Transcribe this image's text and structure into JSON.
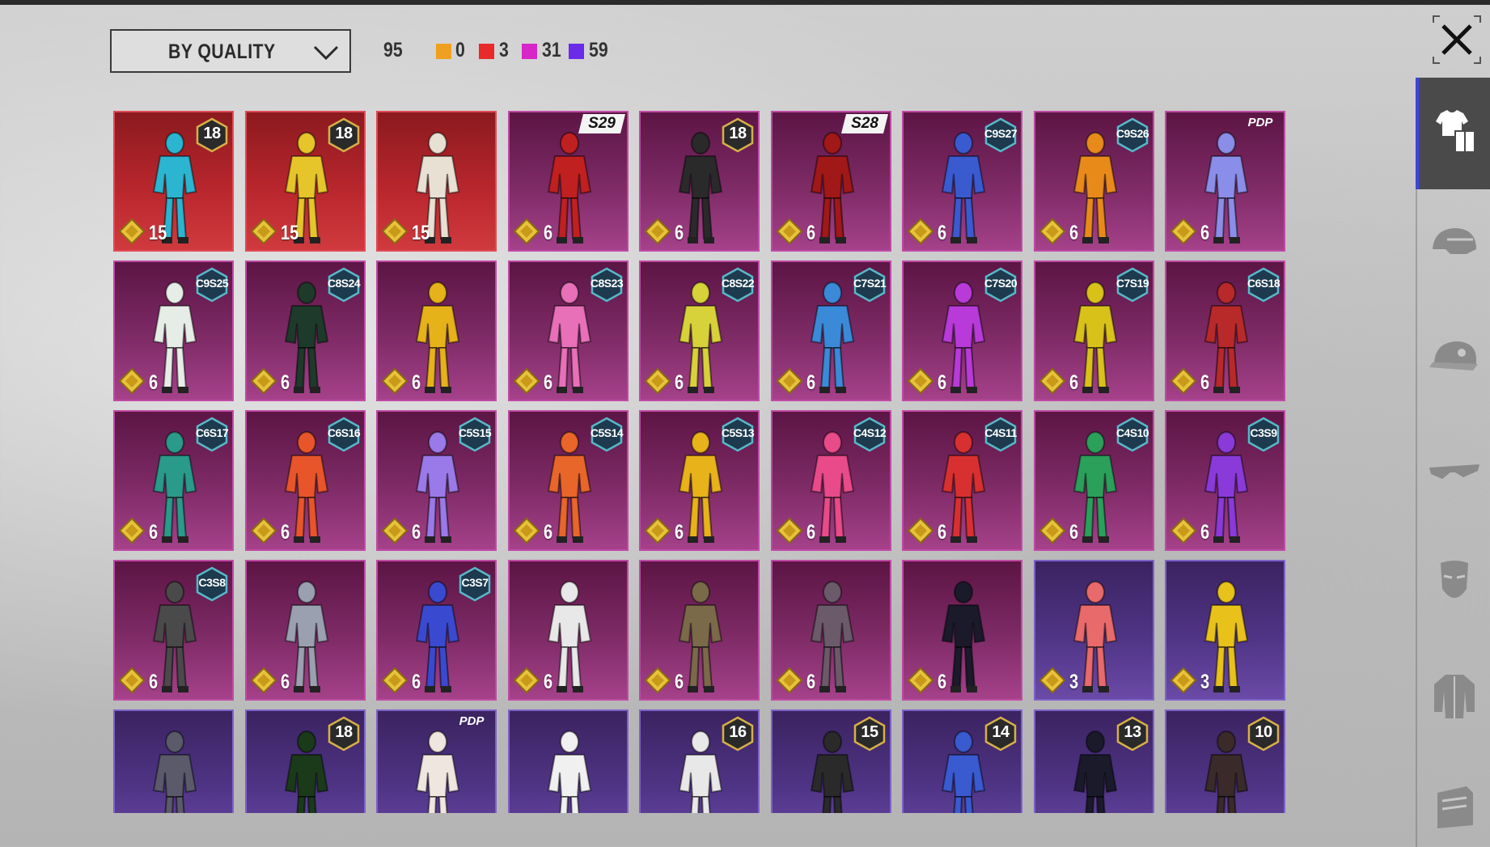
{
  "sort": {
    "label": "BY QUALITY"
  },
  "stats": {
    "total": "95",
    "orange": "0",
    "red": "3",
    "magenta": "31",
    "violet": "59"
  },
  "colors": {
    "orange": "#f0a020",
    "red": "#e82a2a",
    "magenta": "#d827c8",
    "violet": "#6a2ce8",
    "rail_accent": "#3c44e0"
  },
  "rail_icons": [
    "outfit-icon",
    "helmet-icon",
    "cap-icon",
    "glasses-icon",
    "mask-icon",
    "jacket-icon",
    "backpack-icon"
  ],
  "items": [
    {
      "rarity": "red",
      "cost": "15",
      "badge": "18",
      "badge_type": "age",
      "tone": "#2bb5d0"
    },
    {
      "rarity": "red",
      "cost": "15",
      "badge": "18",
      "badge_type": "age",
      "tone": "#e6c52a"
    },
    {
      "rarity": "red",
      "cost": "15",
      "badge": "",
      "badge_type": "",
      "tone": "#e8e0d2"
    },
    {
      "rarity": "pink",
      "cost": "6",
      "badge": "S29",
      "badge_type": "season",
      "tone": "#c02020"
    },
    {
      "rarity": "pink",
      "cost": "6",
      "badge": "18",
      "badge_type": "age",
      "tone": "#2a2a2a"
    },
    {
      "rarity": "pink",
      "cost": "6",
      "badge": "S28",
      "badge_type": "season",
      "tone": "#a01818"
    },
    {
      "rarity": "pink",
      "cost": "6",
      "badge": "C9S27",
      "badge_type": "hex",
      "tone": "#3a5ad0"
    },
    {
      "rarity": "pink",
      "cost": "6",
      "badge": "C9S26",
      "badge_type": "hex",
      "tone": "#e88a1a"
    },
    {
      "rarity": "pink",
      "cost": "6",
      "badge": "PDP",
      "badge_type": "pass",
      "tone": "#8a8ee8"
    },
    {
      "rarity": "pink",
      "cost": "6",
      "badge": "C9S25",
      "badge_type": "hex",
      "tone": "#e6ece6"
    },
    {
      "rarity": "pink",
      "cost": "6",
      "badge": "C8S24",
      "badge_type": "hex",
      "tone": "#1e3a2a"
    },
    {
      "rarity": "pink",
      "cost": "6",
      "badge": "",
      "badge_type": "",
      "tone": "#e6b21a"
    },
    {
      "rarity": "pink",
      "cost": "6",
      "badge": "C8S23",
      "badge_type": "hex",
      "tone": "#e870b8"
    },
    {
      "rarity": "pink",
      "cost": "6",
      "badge": "C8S22",
      "badge_type": "hex",
      "tone": "#d8d23a"
    },
    {
      "rarity": "pink",
      "cost": "6",
      "badge": "C7S21",
      "badge_type": "hex",
      "tone": "#3a8ad8"
    },
    {
      "rarity": "pink",
      "cost": "6",
      "badge": "C7S20",
      "badge_type": "hex",
      "tone": "#b83ad8"
    },
    {
      "rarity": "pink",
      "cost": "6",
      "badge": "C7S19",
      "badge_type": "hex",
      "tone": "#d8c21a"
    },
    {
      "rarity": "pink",
      "cost": "6",
      "badge": "C6S18",
      "badge_type": "hex",
      "tone": "#b82a2a"
    },
    {
      "rarity": "pink",
      "cost": "6",
      "badge": "C6S17",
      "badge_type": "hex",
      "tone": "#2a9a8a"
    },
    {
      "rarity": "pink",
      "cost": "6",
      "badge": "C6S16",
      "badge_type": "hex",
      "tone": "#e8552a"
    },
    {
      "rarity": "pink",
      "cost": "6",
      "badge": "C5S15",
      "badge_type": "hex",
      "tone": "#9a7ae8"
    },
    {
      "rarity": "pink",
      "cost": "6",
      "badge": "C5S14",
      "badge_type": "hex",
      "tone": "#e8662a"
    },
    {
      "rarity": "pink",
      "cost": "6",
      "badge": "C5S13",
      "badge_type": "hex",
      "tone": "#e8b21a"
    },
    {
      "rarity": "pink",
      "cost": "6",
      "badge": "C4S12",
      "badge_type": "hex",
      "tone": "#e84a8a"
    },
    {
      "rarity": "pink",
      "cost": "6",
      "badge": "C4S11",
      "badge_type": "hex",
      "tone": "#d83030"
    },
    {
      "rarity": "pink",
      "cost": "6",
      "badge": "C4S10",
      "badge_type": "hex",
      "tone": "#2aa05a"
    },
    {
      "rarity": "pink",
      "cost": "6",
      "badge": "C3S9",
      "badge_type": "hex",
      "tone": "#8a3ad8"
    },
    {
      "rarity": "pink",
      "cost": "6",
      "badge": "C3S8",
      "badge_type": "hex",
      "tone": "#4a4a4a"
    },
    {
      "rarity": "pink",
      "cost": "6",
      "badge": "",
      "badge_type": "",
      "tone": "#9aa0b0"
    },
    {
      "rarity": "pink",
      "cost": "6",
      "badge": "C3S7",
      "badge_type": "hex",
      "tone": "#3a4ad0"
    },
    {
      "rarity": "pink",
      "cost": "6",
      "badge": "",
      "badge_type": "",
      "tone": "#e8e8e8"
    },
    {
      "rarity": "pink",
      "cost": "6",
      "badge": "",
      "badge_type": "",
      "tone": "#7a6a4a"
    },
    {
      "rarity": "pink",
      "cost": "6",
      "badge": "",
      "badge_type": "",
      "tone": "#6a5a6a"
    },
    {
      "rarity": "pink",
      "cost": "6",
      "badge": "",
      "badge_type": "",
      "tone": "#1a1a2a"
    },
    {
      "rarity": "purple",
      "cost": "3",
      "badge": "",
      "badge_type": "",
      "tone": "#e86a6a"
    },
    {
      "rarity": "purple",
      "cost": "3",
      "badge": "",
      "badge_type": "",
      "tone": "#e8c21a"
    },
    {
      "rarity": "purple",
      "cost": "",
      "badge": "",
      "badge_type": "",
      "tone": "#5a5a6a"
    },
    {
      "rarity": "purple",
      "cost": "",
      "badge": "18",
      "badge_type": "age",
      "tone": "#1a3a1a"
    },
    {
      "rarity": "purple",
      "cost": "",
      "badge": "PDP",
      "badge_type": "pass",
      "tone": "#f0e6e0"
    },
    {
      "rarity": "purple",
      "cost": "",
      "badge": "",
      "badge_type": "",
      "tone": "#f0f0f0"
    },
    {
      "rarity": "purple",
      "cost": "",
      "badge": "16",
      "badge_type": "age",
      "tone": "#e8e8e8"
    },
    {
      "rarity": "purple",
      "cost": "",
      "badge": "15",
      "badge_type": "age",
      "tone": "#2a2a2a"
    },
    {
      "rarity": "purple",
      "cost": "",
      "badge": "14",
      "badge_type": "age",
      "tone": "#3a5ad0"
    },
    {
      "rarity": "purple",
      "cost": "",
      "badge": "13",
      "badge_type": "age",
      "tone": "#1a1a2a"
    },
    {
      "rarity": "purple",
      "cost": "",
      "badge": "10",
      "badge_type": "age",
      "tone": "#3a2a2a"
    }
  ]
}
